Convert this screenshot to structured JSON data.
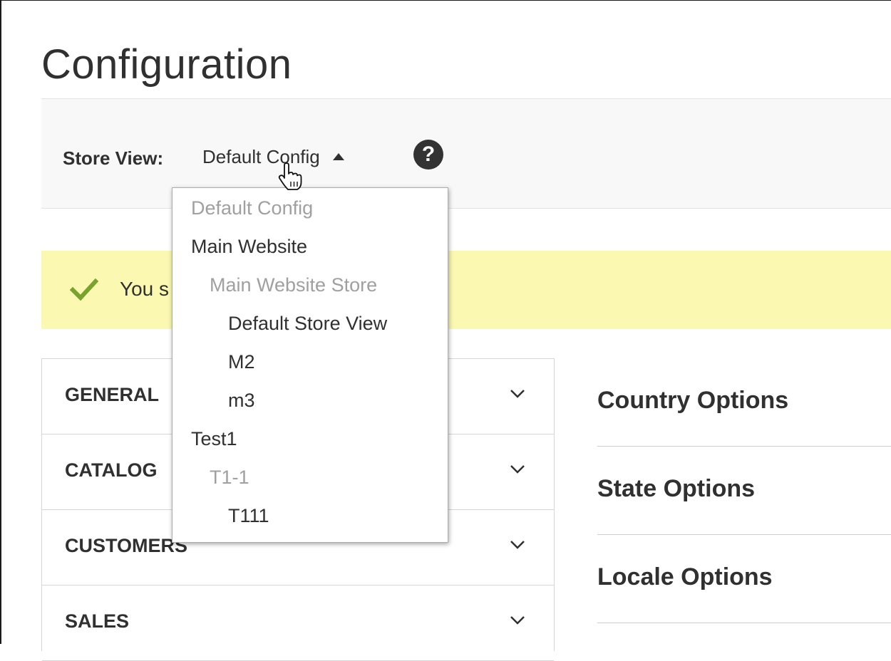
{
  "page": {
    "title": "Configuration"
  },
  "scope": {
    "label": "Store View:",
    "selected": "Default Config",
    "help_icon": "question-circle-icon"
  },
  "message": {
    "visible_text": "You s",
    "icon": "check-icon",
    "accent": "#79a22e"
  },
  "dropdown": {
    "items": [
      {
        "label": "Default Config",
        "level": 0,
        "selectable": false
      },
      {
        "label": "Main Website",
        "level": 0,
        "selectable": true
      },
      {
        "label": "Main Website Store",
        "level": 1,
        "selectable": false
      },
      {
        "label": "Default Store View",
        "level": 2,
        "selectable": true
      },
      {
        "label": "M2",
        "level": 2,
        "selectable": true
      },
      {
        "label": "m3",
        "level": 2,
        "selectable": true
      },
      {
        "label": "Test1",
        "level": 0,
        "selectable": true
      },
      {
        "label": "T1-1",
        "level": 1,
        "selectable": false
      },
      {
        "label": "T111",
        "level": 2,
        "selectable": true
      }
    ]
  },
  "tabs": [
    {
      "label": "GENERAL",
      "icon": "chevron-down-icon"
    },
    {
      "label": "CATALOG",
      "icon": "chevron-down-icon"
    },
    {
      "label": "CUSTOMERS",
      "icon": "chevron-down-icon"
    },
    {
      "label": "SALES",
      "icon": "chevron-down-icon"
    }
  ],
  "sections": [
    {
      "title": "Country Options"
    },
    {
      "title": "State Options"
    },
    {
      "title": "Locale Options"
    }
  ],
  "colors": {
    "text": "#303030",
    "muted": "#a0a0a0",
    "message_bg": "#fbf8b2",
    "scope_bg": "#f8f8f8"
  }
}
